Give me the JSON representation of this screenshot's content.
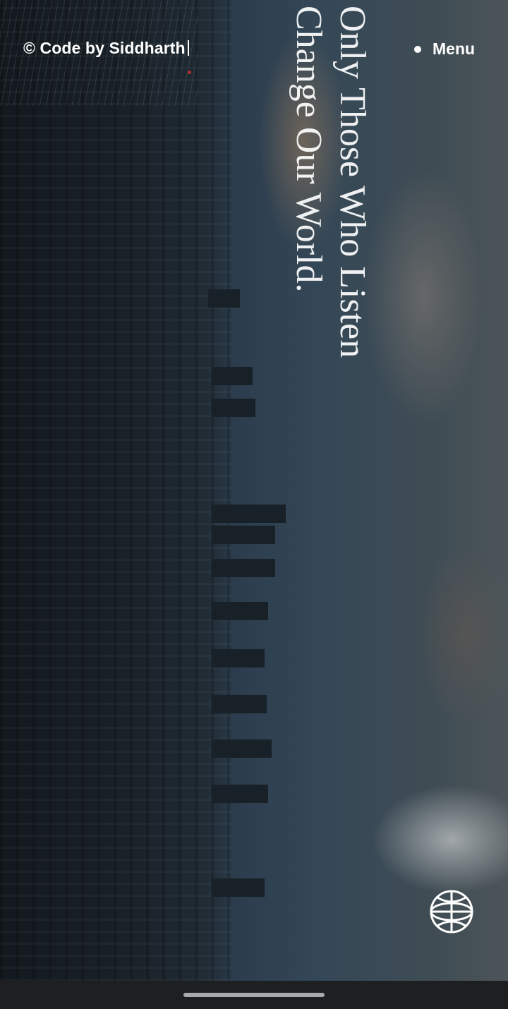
{
  "header": {
    "brand": "© Code by Siddharth",
    "menu_label": "Menu"
  },
  "hero": {
    "headline_line1": "Only Those Who Listen",
    "headline_line2": "Change Our World."
  },
  "icons": {
    "globe": "globe-icon",
    "menu_dot": "dot-icon"
  },
  "colors": {
    "text": "#ffffff",
    "navbar": "#1e1f21",
    "home_indicator": "#a9aaac"
  }
}
